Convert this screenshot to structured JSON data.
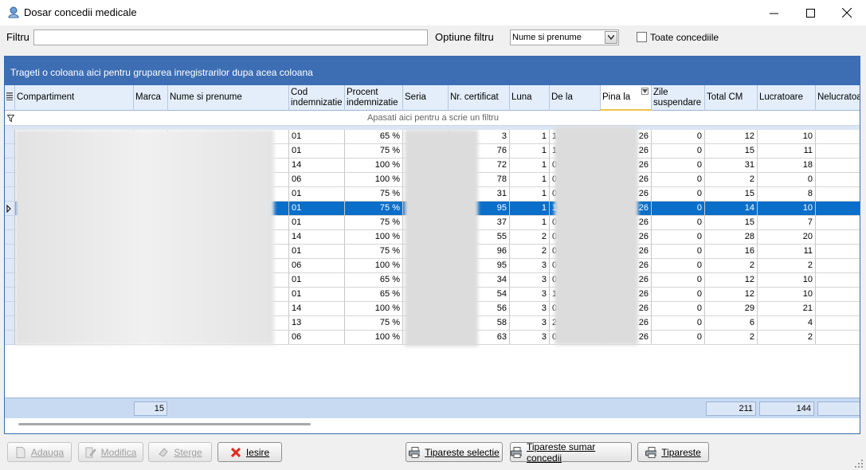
{
  "window": {
    "title": "Dosar concedii medicale"
  },
  "filter": {
    "label": "Filtru",
    "value": "",
    "option_label": "Optiune filtru",
    "option_value": "Nume si prenume",
    "all_leaves_label": "Toate concediile",
    "all_leaves_checked": false
  },
  "grid": {
    "group_hint": "Trageti o coloana aici pentru gruparea inregistrarilor dupa acea coloana",
    "filter_hint": "Apasati aici pentru a scrie un filtru",
    "columns": [
      "Compartiment",
      "Marca",
      "Nume si prenume",
      "Cod\nindemnizatie",
      "Procent\nindemnizatie",
      "Seria",
      "Nr. certificat",
      "Luna",
      "De la",
      "Pina la",
      "Zile\nsuspendare",
      "Total CM",
      "Lucratoare",
      "Nelucratoa"
    ],
    "rows": [
      {
        "cod": "01",
        "procent": "65 %",
        "nr": "3",
        "luna": "1",
        "dela": "1",
        "pina": "26",
        "zile": "0",
        "total": "12",
        "lucr": "10"
      },
      {
        "cod": "01",
        "procent": "75 %",
        "nr": "76",
        "luna": "1",
        "dela": "1",
        "pina": "26",
        "zile": "0",
        "total": "15",
        "lucr": "11"
      },
      {
        "cod": "14",
        "procent": "100 %",
        "nr": "72",
        "luna": "1",
        "dela": "0",
        "pina": "26",
        "zile": "0",
        "total": "31",
        "lucr": "18"
      },
      {
        "cod": "06",
        "procent": "100 %",
        "nr": "78",
        "luna": "1",
        "dela": "0",
        "pina": "26",
        "zile": "0",
        "total": "2",
        "lucr": "0"
      },
      {
        "cod": "01",
        "procent": "75 %",
        "nr": "31",
        "luna": "1",
        "dela": "0",
        "pina": "26",
        "zile": "0",
        "total": "15",
        "lucr": "8"
      },
      {
        "cod": "01",
        "procent": "75 %",
        "nr": "95",
        "luna": "1",
        "dela": "1",
        "pina": "26",
        "zile": "0",
        "total": "14",
        "lucr": "10"
      },
      {
        "cod": "01",
        "procent": "75 %",
        "nr": "37",
        "luna": "1",
        "dela": "0",
        "pina": "26",
        "zile": "0",
        "total": "15",
        "lucr": "7"
      },
      {
        "cod": "14",
        "procent": "100 %",
        "nr": "55",
        "luna": "2",
        "dela": "0",
        "pina": "26",
        "zile": "0",
        "total": "28",
        "lucr": "20"
      },
      {
        "cod": "01",
        "procent": "75 %",
        "nr": "96",
        "luna": "2",
        "dela": "0",
        "pina": "26",
        "zile": "0",
        "total": "16",
        "lucr": "11"
      },
      {
        "cod": "06",
        "procent": "100 %",
        "nr": "95",
        "luna": "3",
        "dela": "0",
        "pina": "26",
        "zile": "0",
        "total": "2",
        "lucr": "2"
      },
      {
        "cod": "01",
        "procent": "65 %",
        "nr": "34",
        "luna": "3",
        "dela": "0",
        "pina": "26",
        "zile": "0",
        "total": "12",
        "lucr": "10"
      },
      {
        "cod": "01",
        "procent": "65 %",
        "nr": "54",
        "luna": "3",
        "dela": "1",
        "pina": "26",
        "zile": "0",
        "total": "12",
        "lucr": "10"
      },
      {
        "cod": "14",
        "procent": "100 %",
        "nr": "56",
        "luna": "3",
        "dela": "0",
        "pina": "26",
        "zile": "0",
        "total": "29",
        "lucr": "21"
      },
      {
        "cod": "13",
        "procent": "75 %",
        "nr": "58",
        "luna": "3",
        "dela": "2",
        "pina": "26",
        "zile": "0",
        "total": "6",
        "lucr": "4"
      },
      {
        "cod": "06",
        "procent": "100 %",
        "nr": "63",
        "luna": "3",
        "dela": "0",
        "pina": "26",
        "zile": "0",
        "total": "2",
        "lucr": "2"
      }
    ],
    "selected_row": 5,
    "footer": {
      "count": "15",
      "total_cm": "211",
      "lucratoare": "144"
    }
  },
  "buttons": {
    "add": "Adauga",
    "edit": "Modifica",
    "delete": "Sterge",
    "exit": "Iesire",
    "print_selection": "Tipareste selectie",
    "print_summary": "Tipareste sumar concedii",
    "print": "Tipareste"
  },
  "colors": {
    "group_panel": "#3d6eb4",
    "selected_row": "#0b6ec9",
    "header": "#e4eefa",
    "footer": "#c8daf2"
  }
}
